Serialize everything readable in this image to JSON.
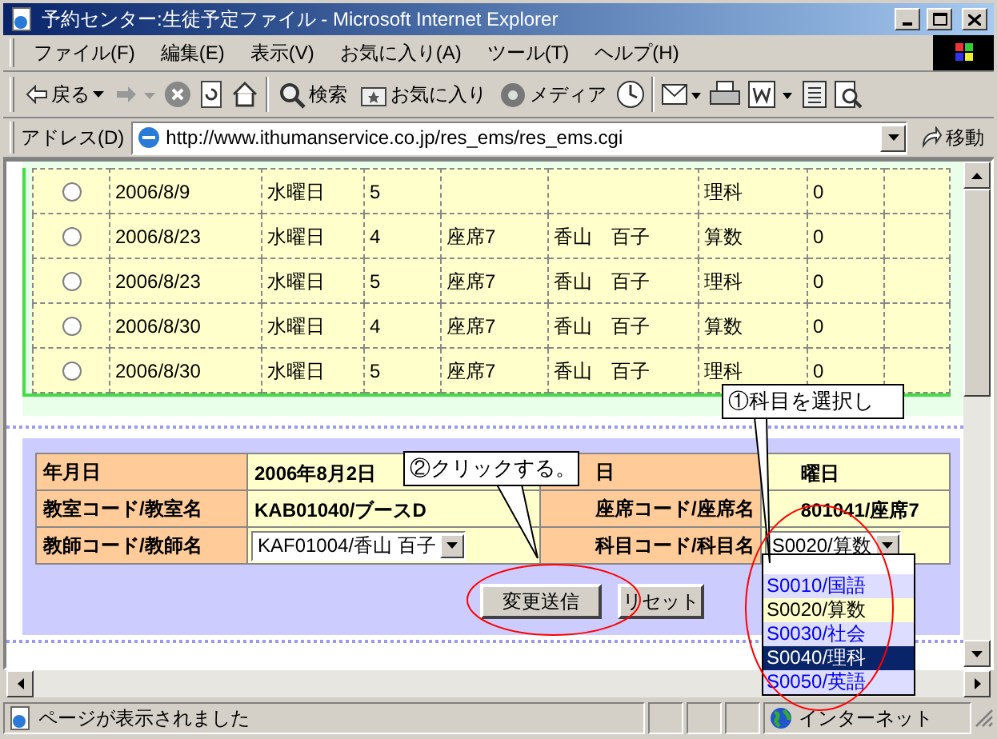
{
  "window": {
    "title": "予約センター:生徒予定ファイル - Microsoft Internet Explorer"
  },
  "menu": [
    "ファイル(F)",
    "編集(E)",
    "表示(V)",
    "お気に入り(A)",
    "ツール(T)",
    "ヘルプ(H)"
  ],
  "toolbar": {
    "back": "戻る",
    "search": "検索",
    "favorites": "お気に入り",
    "media": "メディア"
  },
  "address": {
    "label": "アドレス(D)",
    "url": "http://www.ithumanservice.co.jp/res_ems/res_ems.cgi",
    "go": "移動"
  },
  "table": {
    "rows": [
      {
        "selected": false,
        "cells": [
          "2006/8/9",
          "水曜日",
          "5",
          "",
          "",
          "理科",
          "0"
        ]
      },
      {
        "selected": false,
        "cells": [
          "2006/8/23",
          "水曜日",
          "4",
          "座席7",
          "香山　百子",
          "算数",
          "0"
        ]
      },
      {
        "selected": false,
        "cells": [
          "2006/8/23",
          "水曜日",
          "5",
          "座席7",
          "香山　百子",
          "理科",
          "0"
        ]
      },
      {
        "selected": false,
        "cells": [
          "2006/8/30",
          "水曜日",
          "4",
          "座席7",
          "香山　百子",
          "算数",
          "0"
        ]
      },
      {
        "selected": false,
        "cells": [
          "2006/8/30",
          "水曜日",
          "5",
          "座席7",
          "香山　百子",
          "理科",
          "0"
        ]
      }
    ]
  },
  "form": {
    "rows": [
      [
        {
          "kind": "label",
          "text": "年月日"
        },
        {
          "kind": "value",
          "text": "2006年8月2日"
        },
        {
          "kind": "label",
          "text": "日"
        },
        {
          "kind": "value",
          "text": "曜日"
        }
      ],
      [
        {
          "kind": "label",
          "text": "教室コード/教室名"
        },
        {
          "kind": "value",
          "text": "KAB01040/ブースD"
        },
        {
          "kind": "label",
          "text": "座席コード/座席名"
        },
        {
          "kind": "value",
          "text": "801041/座席7"
        }
      ],
      [
        {
          "kind": "label",
          "text": "教師コード/教師名"
        },
        {
          "kind": "select",
          "text": "KAF01004/香山 百子"
        },
        {
          "kind": "label",
          "text": "科目コード/科目名"
        },
        {
          "kind": "select",
          "text": "S0020/算数"
        }
      ]
    ],
    "buttons": [
      "変更送信",
      "リセット"
    ]
  },
  "dropdown": {
    "options": [
      {
        "text": "S0010/国語",
        "current": false,
        "selected": false
      },
      {
        "text": "S0020/算数",
        "current": true,
        "selected": false
      },
      {
        "text": "S0030/社会",
        "current": false,
        "selected": false
      },
      {
        "text": "S0040/理科",
        "current": false,
        "selected": true
      },
      {
        "text": "S0050/英語",
        "current": false,
        "selected": false
      }
    ]
  },
  "callouts": [
    {
      "kind": "select",
      "text": "①科目を選択し"
    },
    {
      "kind": "click",
      "text": "②クリックする。"
    }
  ],
  "status_bar": {
    "text": "ページが表示されました",
    "zone": "インターネット"
  }
}
